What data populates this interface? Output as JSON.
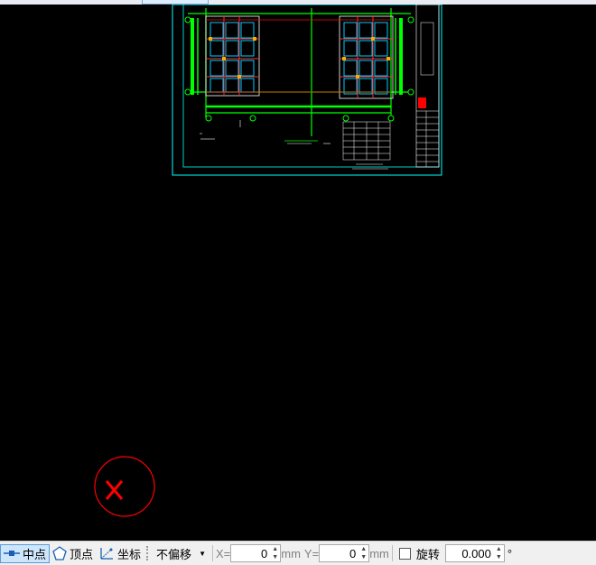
{
  "status_bar": {
    "snap_midpoint_label": "中点",
    "snap_vertex_label": "顶点",
    "snap_coord_label": "坐标",
    "offset_mode": "不偏移",
    "x_label": "X=",
    "x_value": "0",
    "x_unit": "mm",
    "y_label": "Y=",
    "y_value": "0",
    "y_unit": "mm",
    "rotate_label": "旋转",
    "rotate_value": "0.000",
    "degree_symbol": "°"
  },
  "drawing": {
    "icons": [
      "crosshair-cursor-icon",
      "error-x-icon"
    ],
    "colors": {
      "grid": "#00ff00",
      "frame": "#00ffff",
      "red": "#ff0000",
      "background": "#000000"
    }
  }
}
